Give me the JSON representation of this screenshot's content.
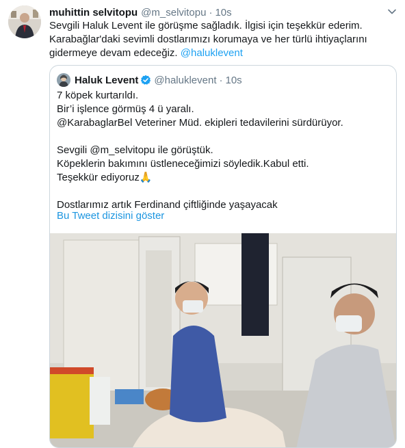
{
  "tweet": {
    "author_name": "muhittin selvitopu",
    "author_handle": "@m_selvitopu",
    "separator": "·",
    "time": "10s",
    "text_lines": [
      "Sevgili Haluk Levent ile görüşme sağladık. İlgisi için teşekkür ederim.",
      "Karabağlar'daki sevimli dostlarımızı korumaya ve her türlü ihtiyaçlarını",
      "gidermeye devam edeceğiz."
    ],
    "mention": "@haluklevent",
    "menu_icon": "chevron-down-icon"
  },
  "quoted": {
    "author_name": "Haluk Levent",
    "author_handle": "@haluklevent",
    "separator": "·",
    "time": "10s",
    "verified_icon": "verified-badge-icon",
    "lines": [
      "7 köpek kurtarıldı.",
      "Bir’i işlence görmüş 4 ü yaralı.",
      "@KarabaglarBel Veteriner Müd. ekipleri tedavilerini sürdürüyor.",
      "",
      "Sevgili @m_selvitopu ile görüştük.",
      "Köpeklerin bakımını üstleneceğimizi söyledik.Kabul etti.",
      "Teşekkür ediyoruz🙏",
      "",
      "Dostlarımız artık Ferdinand çiftliğinde yaşayacak"
    ],
    "show_thread": "Bu Tweet dizisini göster"
  },
  "colors": {
    "link": "#1da1f2",
    "secondary": "#657786",
    "border": "#ccd6dd"
  }
}
